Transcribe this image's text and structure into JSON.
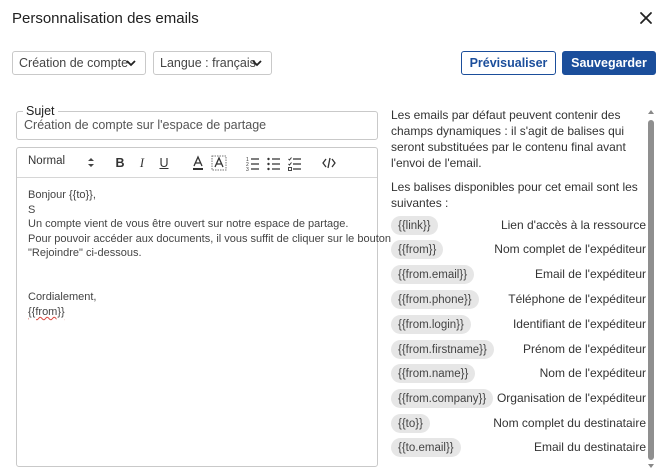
{
  "header": {
    "title": "Personnalisation des emails"
  },
  "toolbar": {
    "template_select": "Création de compte",
    "language_select": "Langue : français",
    "preview_label": "Prévisualiser",
    "save_label": "Sauvegarder"
  },
  "subject": {
    "label": "Sujet",
    "value": "Création de compte sur l'espace de partage"
  },
  "editor": {
    "format_select": "Normal",
    "tools": [
      "bold-icon",
      "italic-icon",
      "underline-icon",
      "font-color-icon",
      "highlight-icon",
      "ordered-list-icon",
      "bullet-list-icon",
      "checklist-icon",
      "code-icon"
    ],
    "lines": [
      "Bonjour {{to}},",
      "S",
      "Un compte vient de vous être ouvert sur notre espace de partage.",
      "Pour pouvoir accéder aux documents, il vous suffit de cliquer sur le bouton",
      "\"Rejoindre\" ci-dessous.",
      "",
      "",
      "Cordialement,",
      "{{from}}"
    ]
  },
  "help": {
    "intro": "Les emails par défaut peuvent contenir des champs dynamiques : il s'agit de balises qui seront substituées par le contenu final avant l'envoi de l'email.",
    "available": "Les balises disponibles pour cet email sont les suivantes :",
    "tags": [
      {
        "tag": "{{link}}",
        "desc": "Lien d'accès à la ressource"
      },
      {
        "tag": "{{from}}",
        "desc": "Nom complet de l'expéditeur"
      },
      {
        "tag": "{{from.email}}",
        "desc": "Email de l'expéditeur"
      },
      {
        "tag": "{{from.phone}}",
        "desc": "Téléphone de l'expéditeur"
      },
      {
        "tag": "{{from.login}}",
        "desc": "Identifiant de l'expéditeur"
      },
      {
        "tag": "{{from.firstname}}",
        "desc": "Prénom de l'expéditeur"
      },
      {
        "tag": "{{from.name}}",
        "desc": "Nom de l'expéditeur"
      },
      {
        "tag": "{{from.company}}",
        "desc": "Organisation de l'expéditeur"
      },
      {
        "tag": "{{to}}",
        "desc": "Nom complet du destinataire"
      },
      {
        "tag": "{{to.email}}",
        "desc": "Email du destinataire"
      }
    ]
  },
  "colors": {
    "primary": "#1b4e9b",
    "tag_bg": "#e6e6e6",
    "border": "#c9c9c9"
  }
}
